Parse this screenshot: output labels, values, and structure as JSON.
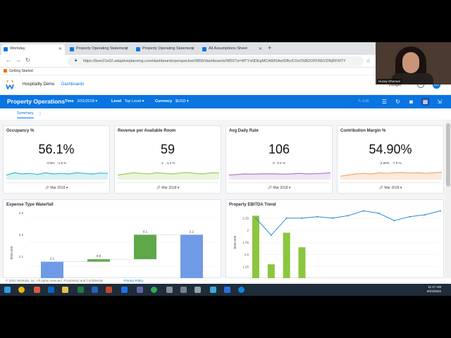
{
  "browser": {
    "tabs": [
      {
        "label": "Workday",
        "fav": "#0875e1"
      },
      {
        "label": "Property Operating Statement",
        "fav": "#0875e1"
      },
      {
        "label": "Property Operating Statement",
        "fav": "#0875e1"
      },
      {
        "label": "All Assumptions Sheet",
        "fav": "#0875e1"
      }
    ],
    "url": "https://livec01s02.adaptiveplanning.com/dashboards/perspective/9856/dashboards/9855?a=MTYxNDEgMCAtMSAwIDBoIC0sOSBDOFFREVDNjRFMTY",
    "bookmark": "Getting Started"
  },
  "app": {
    "name": "Hospitality Demo",
    "nav": "Dashboards",
    "budget": "Budget",
    "user_initials": "HG"
  },
  "dashbar": {
    "title": "Property Operations",
    "time_label": "Time",
    "time_value": "3/31/2018",
    "level_label": "Level",
    "level_value": "Top Level",
    "currency_label": "Currency",
    "currency_value": "$USD",
    "edit_label": "Edit"
  },
  "summary_tab": "Summary",
  "kpis": [
    {
      "title": "Occupancy %",
      "value": "56.1%",
      "d1": "-0.9%",
      "d2": "-1.6 %",
      "period": "Mar 2018",
      "color": "#3bb9c9",
      "fill": "#d8f1f4",
      "trend": [
        0.4,
        0.6,
        0.5,
        0.55,
        0.45,
        0.6,
        0.5,
        0.55,
        0.5,
        0.6,
        0.55,
        0.5,
        0.58,
        0.55
      ]
    },
    {
      "title": "Revenue per Available Room",
      "value": "59",
      "d1": "-1",
      "d2": "-1.2 %",
      "period": "Mar 2018",
      "color": "#9ccc5a",
      "fill": "#eaf5dc",
      "trend": [
        0.4,
        0.5,
        0.6,
        0.55,
        0.5,
        0.6,
        0.55,
        0.5,
        0.58,
        0.62,
        0.55,
        0.5,
        0.6,
        0.58
      ]
    },
    {
      "title": "Avg Daily Rate",
      "value": "106",
      "d1": "0",
      "d2": "0.4 %",
      "period": "Mar 2018",
      "color": "#a77bc9",
      "fill": "#efe5f6",
      "trend": [
        0.4,
        0.45,
        0.5,
        0.48,
        0.5,
        0.52,
        0.5,
        0.48,
        0.5,
        0.55,
        0.5,
        0.52,
        0.55,
        0.6
      ]
    },
    {
      "title": "Contribution Margin %",
      "value": "54.90%",
      "d1": "-2.50%",
      "d2": "-7.0 %",
      "period": "Mar 2018",
      "color": "#f2a66e",
      "fill": "#fdeadb",
      "trend": [
        0.3,
        0.4,
        0.5,
        0.55,
        0.5,
        0.6,
        0.55,
        0.6,
        0.62,
        0.58,
        0.6,
        0.55,
        0.6,
        0.65
      ]
    }
  ],
  "waterfall": {
    "title": "Expense Type Waterfall",
    "ylabel": "$000,000",
    "yticks": [
      "2.3",
      "2.2",
      "2.1"
    ],
    "bar_labels": [
      "2.1",
      "0.0",
      "0.1",
      "2.2"
    ]
  },
  "ebitda": {
    "title": "Property EBITDA Trend",
    "ylabel": "$000,000",
    "yticks": [
      "2.25",
      "2",
      "1.75",
      "1.5",
      "1.25"
    ]
  },
  "chart_data": [
    {
      "type": "bar",
      "title": "Expense Type Waterfall",
      "ylabel": "$000,000",
      "ylim": [
        2.05,
        2.32
      ],
      "bars": [
        {
          "label": "2.1",
          "start": 2.05,
          "end": 2.12,
          "color": "#6f9be6"
        },
        {
          "label": "0.0",
          "start": 2.12,
          "end": 2.13,
          "color": "#5fa84a"
        },
        {
          "label": "0.1",
          "start": 2.13,
          "end": 2.23,
          "color": "#5fa84a"
        },
        {
          "label": "2.2",
          "start": 2.05,
          "end": 2.23,
          "color": "#6f9be6"
        }
      ]
    },
    {
      "type": "bar",
      "title": "Property EBITDA Trend",
      "ylabel": "$000,000",
      "ylim": [
        1.0,
        2.45
      ],
      "bars": [
        2.3,
        1.3,
        1.95,
        1.65
      ],
      "line": [
        2.25,
        1.9,
        2.25,
        2.25,
        2.28,
        2.25,
        2.3,
        2.4,
        2.35,
        2.2,
        2.28,
        2.32,
        2.4
      ]
    }
  ],
  "footer": {
    "copyright": "© 2022 Workday, Inc. All rights reserved. Proprietary and Confidential",
    "privacy": "Privacy Policy"
  },
  "taskbar": {
    "time": "11:17 AM",
    "date": "8/23/2022"
  },
  "webcam": {
    "name": "Huzay Gharwal"
  }
}
